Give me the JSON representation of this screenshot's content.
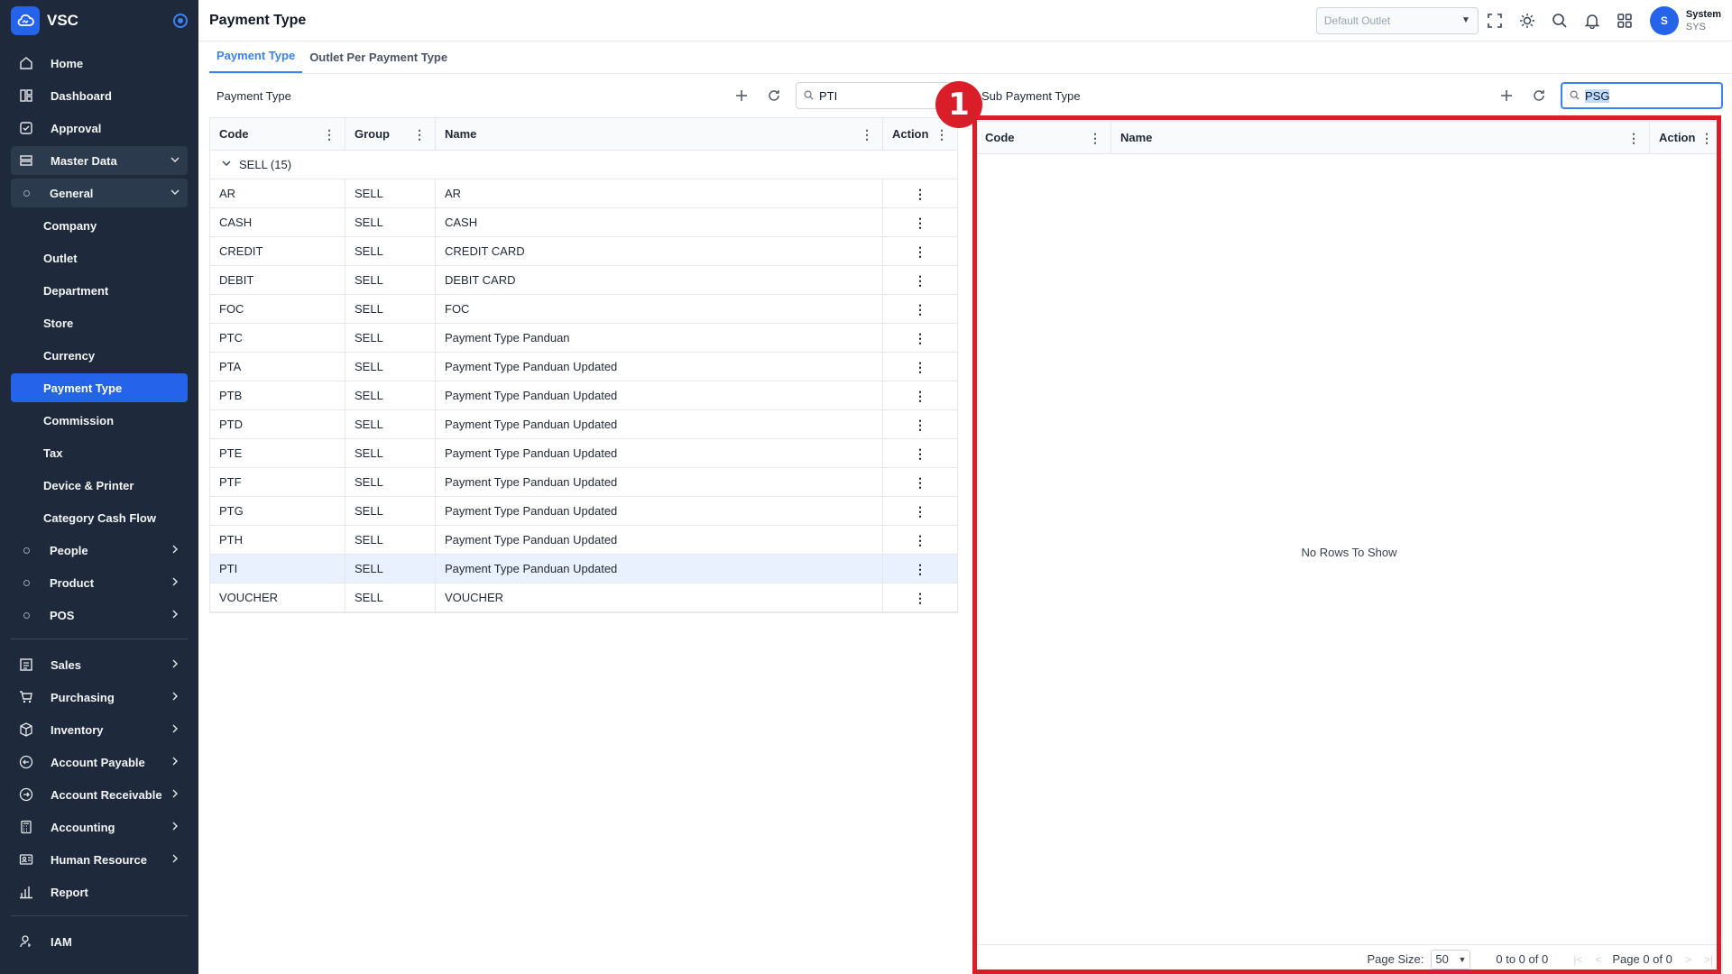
{
  "app": {
    "name": "VSC"
  },
  "header": {
    "title": "Payment Type",
    "outlet_placeholder": "Default Outlet",
    "user_initial": "S",
    "user_name": "System",
    "user_code": "SYS"
  },
  "sidebar": {
    "top": [
      {
        "label": "Home",
        "icon": "home-icon"
      },
      {
        "label": "Dashboard",
        "icon": "dashboard-icon"
      },
      {
        "label": "Approval",
        "icon": "approval-icon"
      },
      {
        "label": "Master Data",
        "icon": "master-data-icon"
      }
    ],
    "general": "General",
    "general_items": [
      "Company",
      "Outlet",
      "Department",
      "Store",
      "Currency",
      "Payment Type",
      "Commission",
      "Tax",
      "Device & Printer",
      "Category Cash Flow"
    ],
    "sub_groups": [
      "People",
      "Product",
      "POS"
    ],
    "bottom": [
      {
        "label": "Sales",
        "icon": "sales-icon"
      },
      {
        "label": "Purchasing",
        "icon": "cart-icon"
      },
      {
        "label": "Inventory",
        "icon": "box-icon"
      },
      {
        "label": "Account Payable",
        "icon": "arrow-left-circle-icon"
      },
      {
        "label": "Account Receivable",
        "icon": "arrow-right-circle-icon"
      },
      {
        "label": "Accounting",
        "icon": "calculator-icon"
      },
      {
        "label": "Human Resource",
        "icon": "id-card-icon"
      },
      {
        "label": "Report",
        "icon": "bar-chart-icon"
      }
    ],
    "iam": "IAM"
  },
  "tabs": [
    "Payment Type",
    "Outlet Per Payment Type"
  ],
  "left": {
    "title": "Payment Type",
    "search": "PTI",
    "columns": [
      "Code",
      "Group",
      "Name",
      "Action"
    ],
    "group_label": "SELL (15)",
    "rows": [
      [
        "AR",
        "SELL",
        "AR"
      ],
      [
        "CASH",
        "SELL",
        "CASH"
      ],
      [
        "CREDIT",
        "SELL",
        "CREDIT CARD"
      ],
      [
        "DEBIT",
        "SELL",
        "DEBIT CARD"
      ],
      [
        "FOC",
        "SELL",
        "FOC"
      ],
      [
        "PTC",
        "SELL",
        "Payment Type Panduan"
      ],
      [
        "PTA",
        "SELL",
        "Payment Type Panduan Updated"
      ],
      [
        "PTB",
        "SELL",
        "Payment Type Panduan Updated"
      ],
      [
        "PTD",
        "SELL",
        "Payment Type Panduan Updated"
      ],
      [
        "PTE",
        "SELL",
        "Payment Type Panduan Updated"
      ],
      [
        "PTF",
        "SELL",
        "Payment Type Panduan Updated"
      ],
      [
        "PTG",
        "SELL",
        "Payment Type Panduan Updated"
      ],
      [
        "PTH",
        "SELL",
        "Payment Type Panduan Updated"
      ],
      [
        "PTI",
        "SELL",
        "Payment Type Panduan Updated"
      ],
      [
        "VOUCHER",
        "SELL",
        "VOUCHER"
      ]
    ]
  },
  "right": {
    "title": "Sub Payment Type",
    "search": "PSG",
    "columns": [
      "Code",
      "Name",
      "Action"
    ],
    "empty": "No Rows To Show",
    "page_size_label": "Page Size:",
    "page_size": "50",
    "range": "0 to 0 of 0",
    "page": "Page 0 of 0"
  },
  "annotation": {
    "number": "1",
    "color": "#d91e2a"
  },
  "colors": {
    "accent": "#2563eb",
    "sidebar": "#1e2a3b",
    "selected_row": "#e8f1fd"
  }
}
